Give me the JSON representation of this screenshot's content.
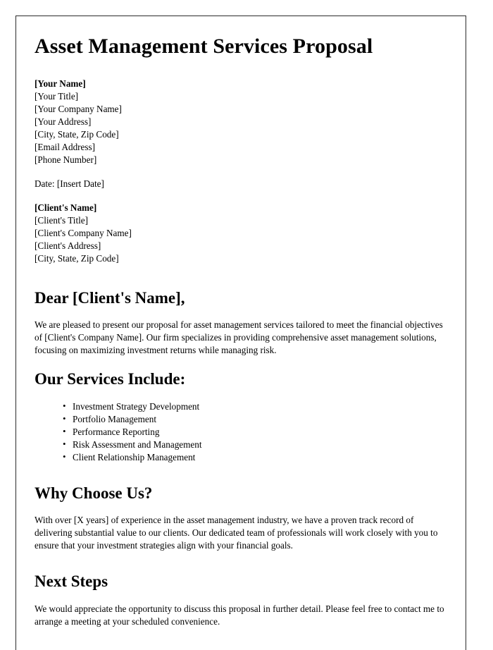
{
  "document": {
    "title": "Asset Management Services Proposal",
    "sender_block": [
      {
        "text": "[Your Name]",
        "bold": true
      },
      {
        "text": "[Your Title]",
        "bold": false
      },
      {
        "text": "[Your Company Name]",
        "bold": false
      },
      {
        "text": "[Your Address]",
        "bold": false
      },
      {
        "text": "[City, State, Zip Code]",
        "bold": false
      },
      {
        "text": "[Email Address]",
        "bold": false
      },
      {
        "text": "[Phone Number]",
        "bold": false
      }
    ],
    "date_line": "Date: [Insert Date]",
    "recipient_block": [
      {
        "text": "[Client's Name]",
        "bold": true
      },
      {
        "text": "[Client's Title]",
        "bold": false
      },
      {
        "text": "[Client's Company Name]",
        "bold": false
      },
      {
        "text": "[Client's Address]",
        "bold": false
      },
      {
        "text": "[City, State, Zip Code]",
        "bold": false
      }
    ],
    "salutation": "Dear [Client's Name],",
    "intro_paragraph": "We are pleased to present our proposal for asset management services tailored to meet the financial objectives of [Client's Company Name]. Our firm specializes in providing comprehensive asset management solutions, focusing on maximizing investment returns while managing risk.",
    "services": {
      "heading": "Our Services Include:",
      "items": [
        "Investment Strategy Development",
        "Portfolio Management",
        "Performance Reporting",
        "Risk Assessment and Management",
        "Client Relationship Management"
      ]
    },
    "why_choose_us": {
      "heading": "Why Choose Us?",
      "paragraph": "With over [X years] of experience in the asset management industry, we have a proven track record of delivering substantial value to our clients. Our dedicated team of professionals will work closely with you to ensure that your investment strategies align with your financial goals."
    },
    "next_steps": {
      "heading": "Next Steps",
      "paragraph": "We would appreciate the opportunity to discuss this proposal in further detail. Please feel free to contact me to arrange a meeting at your scheduled convenience."
    }
  }
}
